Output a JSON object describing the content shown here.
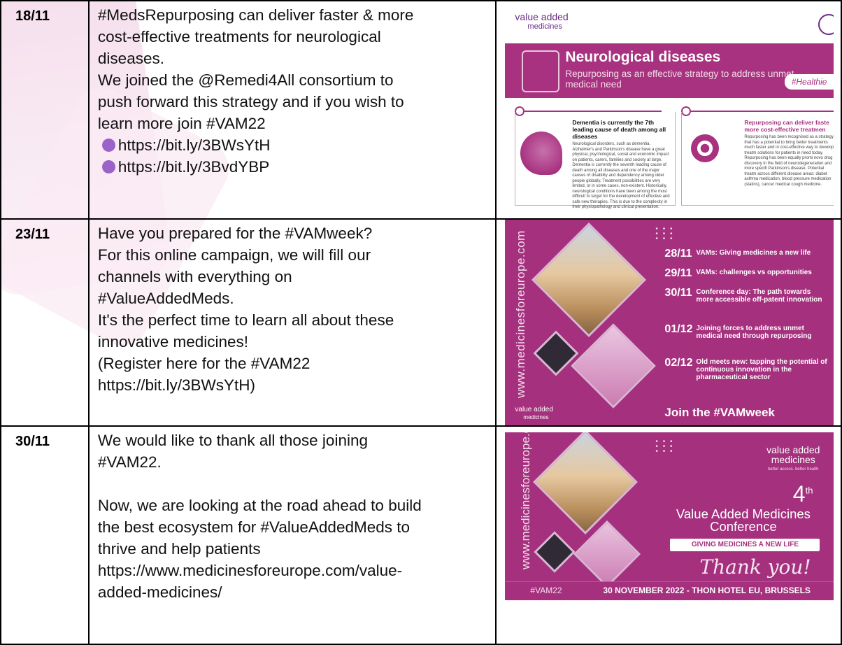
{
  "rows": [
    {
      "date": "18/11",
      "lines": [
        "#MedsRepurposing can deliver faster & more",
        "cost-effective treatments for neurological",
        "diseases.",
        "We joined the @Remedi4All consortium to",
        "push forward this strategy and if you wish to",
        "learn more join #VAM22"
      ],
      "links": [
        "https://bit.ly/3BWsYtH",
        "https://bit.ly/3BvdYBP"
      ],
      "image": {
        "logo": "value added",
        "logo_sub": "medicines",
        "title": "Neurological diseases",
        "subtitle": "Repurposing as an effective strategy to address unmet medical need",
        "tag": "#Healthie",
        "left_heading": "Dementia is currently the 7th leading cause of death among all diseases",
        "left_body": "Neurological disorders, such as dementia, Alzheimer's and Parkinson's disease have a great physical, psychological, social and economic impact on patients, carers, families and society at large. Dementia is currently the seventh leading cause of death among all diseases and one of the major causes of disability and dependency among older people globally. Treatment possibilities are very limited, or in some cases, non-existent. Historically, neurological conditions have been among the most difficult to target for the development of effective and safe new therapies. This is due to the complexity in their physiopathology and clinical presentation. Therefore, curative treatments for several neurological diseases are still lacking.",
        "right_heading": "Repurposing can deliver faste more cost-effective treatmen",
        "right_body": "Repurposing has been recognised as a strategy that has a potential to bring better treatments much faster and in cost-effective way to develop treatm solutions for patients in need today. Repurposing has been equally promi novo drug discovery in the field of neurodegeneration and more specifi Parkinson's disease. Potential treatm across different disease areas: diabet asthma medication, blood pressure medication (statins), cancer medicat cough medicine."
      }
    },
    {
      "date": "23/11",
      "lines": [
        "Have you prepared for the #VAMweek?",
        "For this online campaign, we will fill our",
        "channels with everything on",
        "#ValueAddedMeds.",
        "It's the perfect time to learn all about these",
        "innovative medicines!",
        "(Register here for the #VAM22",
        "https://bit.ly/3BWsYtH)"
      ],
      "image": {
        "vertical_url": "www.medicinesforeurope.com",
        "schedule": [
          {
            "date": "28/11",
            "text": "VAMs: Giving medicines a new life"
          },
          {
            "date": "29/11",
            "text": "VAMs: challenges vs opportunities"
          },
          {
            "date": "30/11",
            "text": "Conference day: The path towards more accessible off-patent innovation"
          },
          {
            "date": "01/12",
            "text": "Joining forces to address unmet medical need through repurposing"
          },
          {
            "date": "02/12",
            "text": "Old meets new: tapping the potential of continuous innovation in the pharmaceutical sector"
          }
        ],
        "cta": "Join the #VAMweek",
        "logo": "value added",
        "logo_sub": "medicines"
      }
    },
    {
      "date": "30/11",
      "lines": [
        "We would like to thank all those joining",
        "#VAM22.",
        "",
        "Now, we are looking at the road ahead to build",
        "the best ecosystem for #ValueAddedMeds to",
        "thrive and help patients",
        "https://www.medicinesforeurope.com/value-",
        "added-medicines/"
      ],
      "image": {
        "vertical_url": "www.medicinesforeurope.com",
        "logo": "value added",
        "logo_sub": "medicines",
        "logo_tagline": "better access. better health",
        "number": "4",
        "number_sup": "th",
        "title_1": "Value Added Medicines",
        "title_2": "Conference",
        "pill": "GIVING MEDICINES A NEW LIFE",
        "thank": "Thank you!",
        "footer_tag": "#VAM22",
        "footer_text": "30 NOVEMBER 2022 - THON HOTEL EU, BRUSSELS"
      }
    }
  ],
  "colors": {
    "brand": "#a5307e",
    "bullet": "#9a63c8"
  }
}
